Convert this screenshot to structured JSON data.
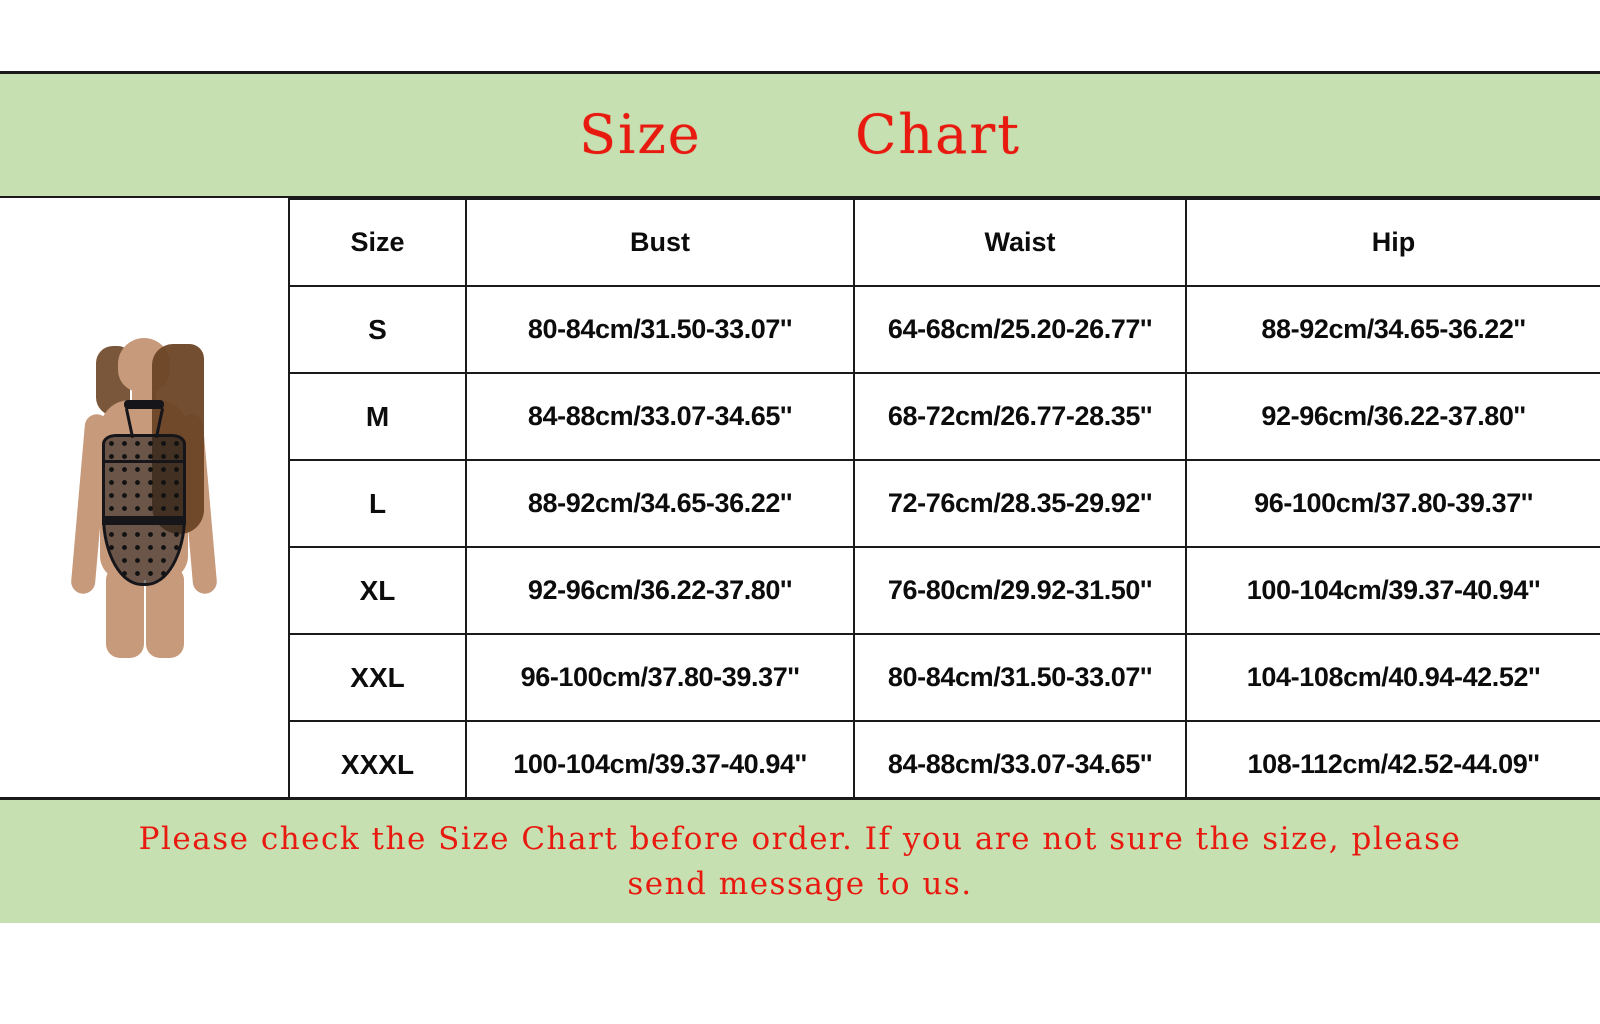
{
  "banner": {
    "title": "Size        Chart",
    "title_color": "#e81a0f",
    "background_color": "#c7e0b2"
  },
  "product": {
    "alt_name": "black polka-dot mesh halter bodysuit on model"
  },
  "table": {
    "headers": [
      "Size",
      "Bust",
      "Waist",
      "Hip"
    ],
    "rows": [
      {
        "size": "S",
        "bust": "80-84cm/31.50-33.07''",
        "waist": "64-68cm/25.20-26.77''",
        "hip": "88-92cm/34.65-36.22''"
      },
      {
        "size": "M",
        "bust": "84-88cm/33.07-34.65''",
        "waist": "68-72cm/26.77-28.35''",
        "hip": "92-96cm/36.22-37.80''"
      },
      {
        "size": "L",
        "bust": "88-92cm/34.65-36.22''",
        "waist": "72-76cm/28.35-29.92''",
        "hip": "96-100cm/37.80-39.37''"
      },
      {
        "size": "XL",
        "bust": "92-96cm/36.22-37.80''",
        "waist": "76-80cm/29.92-31.50''",
        "hip": "100-104cm/39.37-40.94''"
      },
      {
        "size": "XXL",
        "bust": "96-100cm/37.80-39.37''",
        "waist": "80-84cm/31.50-33.07''",
        "hip": "104-108cm/40.94-42.52''"
      },
      {
        "size": "XXXL",
        "bust": "100-104cm/39.37-40.94''",
        "waist": "84-88cm/33.07-34.65''",
        "hip": "108-112cm/42.52-44.09''"
      }
    ]
  },
  "footer": {
    "line1": "Please check the Size Chart before order. If you are not sure the size, please",
    "line2": "send message to us.",
    "text_color": "#e81a0f",
    "background_color": "#c7e0b2"
  }
}
